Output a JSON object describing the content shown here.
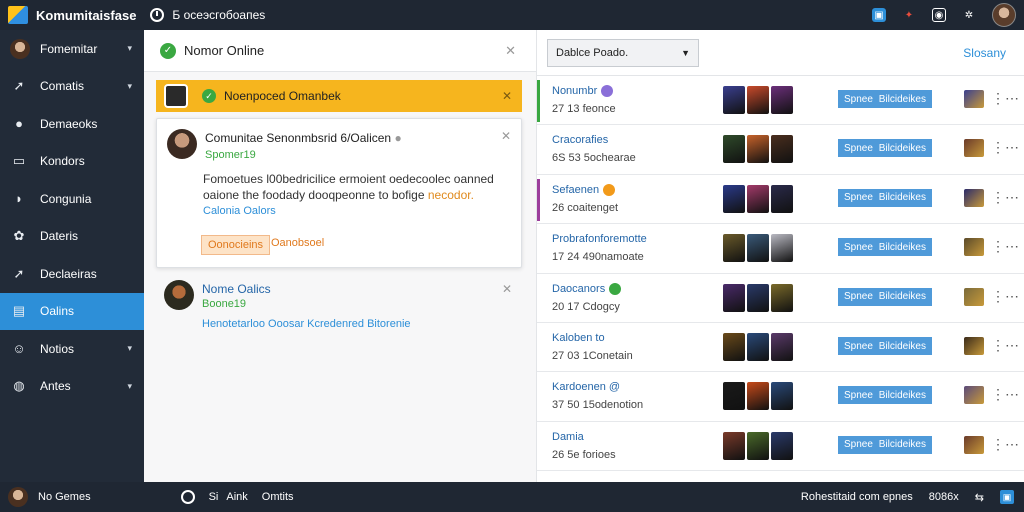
{
  "app": {
    "title": "Komumitaisfase",
    "status_text": "Б осеэсгобоапеs"
  },
  "sidebar": {
    "items": [
      {
        "label": "Fomemitar",
        "icon": "user-avatar"
      },
      {
        "label": "Comatis",
        "icon": "arrow-icon"
      },
      {
        "label": "Demaeoks",
        "icon": "chat-icon"
      },
      {
        "label": "Kondors",
        "icon": "monitor-icon"
      },
      {
        "label": "Congunia",
        "icon": "chat-bubble-icon"
      },
      {
        "label": "Dateris",
        "icon": "settings-icon"
      },
      {
        "label": "Declaeiras",
        "icon": "arrow-icon"
      },
      {
        "label": "Oalins",
        "icon": "window-icon",
        "active": true
      },
      {
        "label": "Notios",
        "icon": "person-icon"
      },
      {
        "label": "Antes",
        "icon": "gauge-icon"
      }
    ],
    "footer_label": "No Gemes"
  },
  "middle": {
    "title": "Nomor Online",
    "banner_text": "Noenpoced Omanbek",
    "card": {
      "title": "Comunitae Senonmbsrid 6/Oalicen",
      "subtitle": "Spomer19",
      "body": "Fomoetues l00bedricilice ermoient oedecoolec oanned oaione the foodady dooqpeonne to bofige",
      "body_highlight": "necodor.",
      "link": "Calonia Oalors",
      "primary_button": "Oonocieins",
      "secondary_button": "Oanobsoel"
    },
    "item": {
      "title": "Nome Oalics",
      "subtitle": "Boone19",
      "link": "Henotetarloo Ooosar Kcredenred Bitorenie"
    }
  },
  "right": {
    "select_value": "Dablce Poado.",
    "header_link": "Slosany",
    "rows": [
      {
        "name": "Nonumbr",
        "meta": "27 13 feonce",
        "badge_color": "#8a6fd8",
        "bar": "#3aa841",
        "button_left": "Spnee",
        "button_right": "Bilcideikes"
      },
      {
        "name": "Cracorafies",
        "meta": "6S 53 5ochearae",
        "badge_color": "",
        "bar": "",
        "button_left": "Spnee",
        "button_right": "Bilcideikes"
      },
      {
        "name": "Sefaenen",
        "meta": "26 coaitenget",
        "badge_color": "#f29a1a",
        "bar": "#9c3e9c",
        "button_left": "Spnee",
        "button_right": "Bilcideikes"
      },
      {
        "name": "Probrafonforemotte",
        "meta": "17 24 490namoate",
        "badge_color": "",
        "bar": "",
        "button_left": "Spnee",
        "button_right": "Bilcideikes"
      },
      {
        "name": "Daocanors",
        "meta": "20 17 Cdogcy",
        "badge_color": "#3aa841",
        "bar": "",
        "button_left": "Spnee",
        "button_right": "Bilcideikes"
      },
      {
        "name": "Kaloben to",
        "meta": "27 03 1Conetain",
        "badge_color": "",
        "bar": "",
        "button_left": "Spnee",
        "button_right": "Bilcideikes"
      },
      {
        "name": "Kardoenen @",
        "meta": "37 50 15odenotion",
        "badge_color": "",
        "bar": "",
        "button_left": "Spnee",
        "button_right": "Bilcideikes"
      },
      {
        "name": "Damia",
        "meta": "26 5e forioes",
        "badge_color": "",
        "bar": "",
        "button_left": "Spnee",
        "button_right": "Bilcideikes"
      }
    ]
  },
  "bottom": {
    "label_1": "Si",
    "label_2": "Aink",
    "label_3": "Omtits",
    "right_text": "Rohestitaid com epnes",
    "right_num": "8086x"
  }
}
